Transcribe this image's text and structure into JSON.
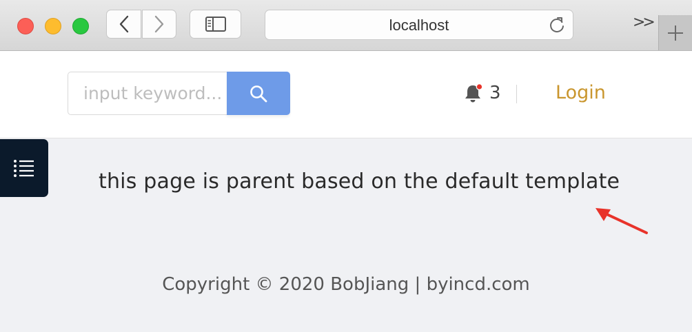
{
  "browser": {
    "url": "localhost",
    "more_label": ">>",
    "icons": {
      "back": "chevron-left-icon",
      "forward": "chevron-right-icon",
      "sidebar": "sidebar-icon",
      "reload": "reload-icon",
      "new_tab": "plus-icon"
    }
  },
  "header": {
    "search": {
      "placeholder": "input keyword...",
      "value": ""
    },
    "notifications": {
      "count": "3"
    },
    "login_label": "Login"
  },
  "main": {
    "message": "this page is parent based on the default template"
  },
  "footer": {
    "copyright": "Copyright © 2020 BobJiang | byincd.com"
  },
  "colors": {
    "search_button": "#6e9be8",
    "login_link": "#c9962e",
    "menu_toggle": "#0b1a2b",
    "annotation_arrow": "#e8332a",
    "notification_dot": "#e8332a"
  }
}
